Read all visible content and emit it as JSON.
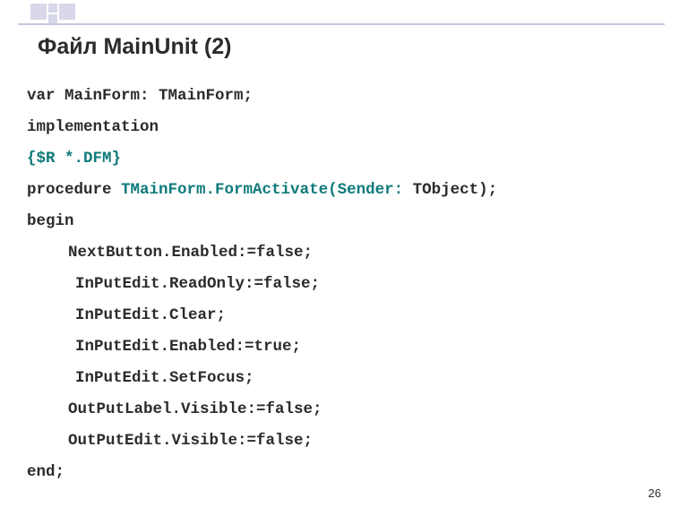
{
  "title": "Файл MainUnit (2)",
  "page_number": "26",
  "code": {
    "l1": "var MainForm: TMainForm;",
    "l2": "implementation",
    "l3": "{$R *.DFM}",
    "l4a": "procedure ",
    "l4b": "TMainForm.FormActivate(Sender:",
    "l4c": " TObject);",
    "l5": "begin",
    "l6": "NextButton.Enabled:=false;",
    "l7": "InPutEdit.ReadOnly:=false;",
    "l8": "InPutEdit.Clear;",
    "l9": "InPutEdit.Enabled:=true;",
    "l10": "InPutEdit.SetFocus;",
    "l11": "OutPutLabel.Visible:=false;",
    "l12": "OutPutEdit.Visible:=false;",
    "l13": "end;"
  }
}
